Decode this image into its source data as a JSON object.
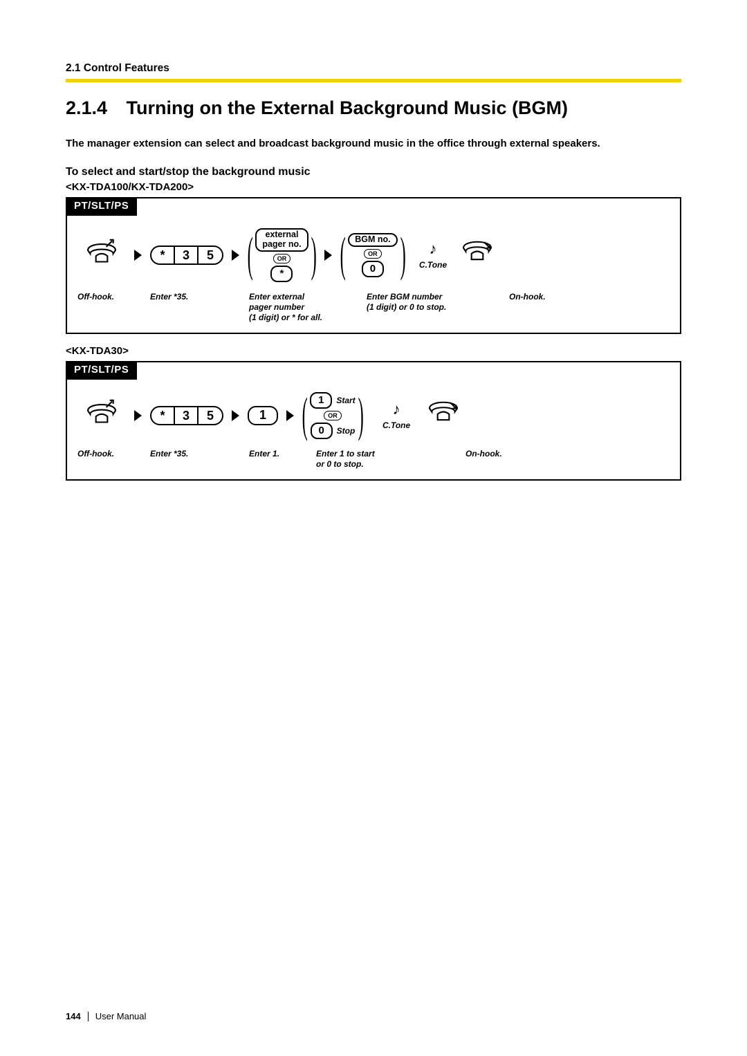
{
  "header": {
    "section_crumb": "2.1 Control Features"
  },
  "title": {
    "number": "2.1.4",
    "text": "Turning on the External Background Music (BGM)"
  },
  "intro": "The manager extension can select and broadcast background music in the office through external speakers.",
  "subhead": "To select and start/stop the background music",
  "model1": "<KX-TDA100/KX-TDA200>",
  "model2": "<KX-TDA30>",
  "tab_label": "PT/SLT/PS",
  "keys": {
    "star": "*",
    "three": "3",
    "five": "5",
    "one": "1",
    "zero": "0"
  },
  "labels": {
    "external_pager_no": "external\npager no.",
    "bgm_no": "BGM no.",
    "or": "OR",
    "ctone": "C.Tone",
    "start": "Start",
    "stop": "Stop"
  },
  "captions": {
    "offhook": "Off-hook.",
    "enter35_pre": "Enter ",
    "enter35_val": "*35.",
    "enter_external": "Enter external\npager number\n(1 digit) or * for all.",
    "enter_bgm": "Enter BGM number\n(1 digit) or 0 to stop.",
    "onhook": "On-hook.",
    "enter1_pre": "Enter ",
    "enter1_val": "1.",
    "enter_start_stop": "Enter 1 to start\nor 0 to stop."
  },
  "footer": {
    "page": "144",
    "doc": "User Manual"
  }
}
